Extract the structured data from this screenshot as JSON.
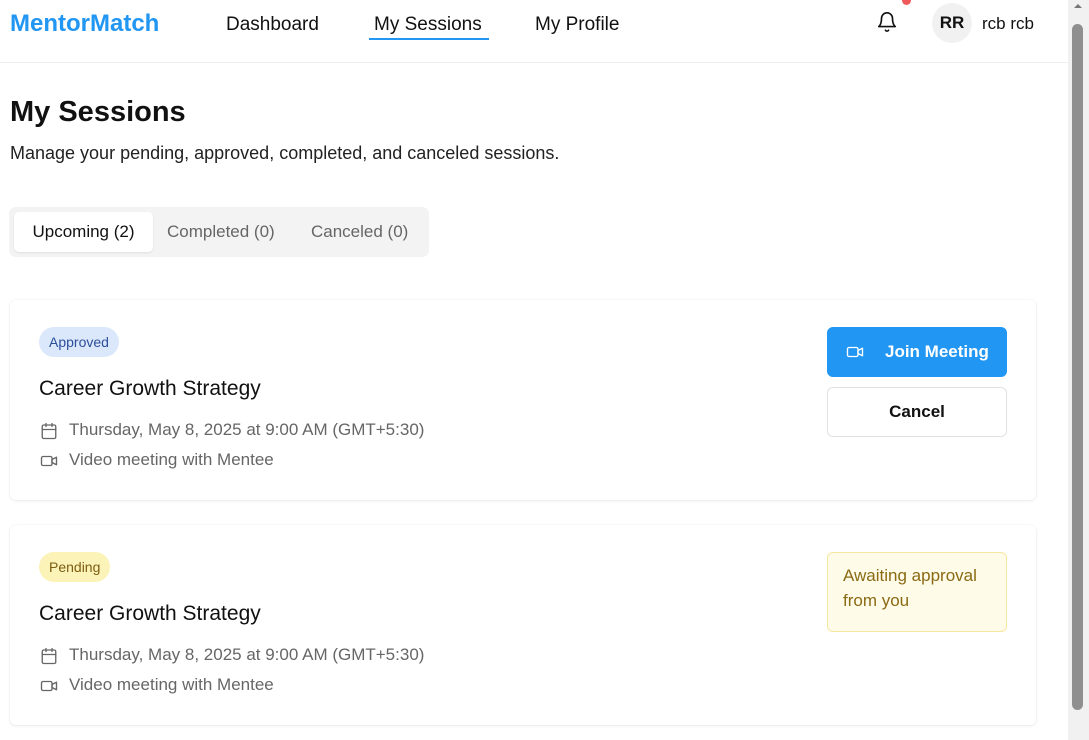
{
  "header": {
    "brand": "MentorMatch",
    "nav": {
      "dashboard": "Dashboard",
      "sessions": "My Sessions",
      "profile": "My Profile"
    },
    "avatar_initials": "RR",
    "username": "rcb rcb",
    "icons": {
      "notifications": "bell-icon"
    }
  },
  "page": {
    "title": "My Sessions",
    "subtitle": "Manage your pending, approved, completed, and canceled sessions."
  },
  "tabs": {
    "upcoming": "Upcoming (2)",
    "completed": "Completed (0)",
    "canceled": "Canceled (0)",
    "active": "upcoming"
  },
  "sessions": [
    {
      "status": "Approved",
      "title": "Career Growth Strategy",
      "datetime": "Thursday, May 8, 2025 at 9:00 AM (GMT+5:30)",
      "meeting_type": "Video meeting with Mentee",
      "join_label": "Join Meeting",
      "cancel_label": "Cancel"
    },
    {
      "status": "Pending",
      "title": "Career Growth Strategy",
      "datetime": "Thursday, May 8, 2025 at 9:00 AM (GMT+5:30)",
      "meeting_type": "Video meeting with Mentee",
      "awaiting_text": "Awaiting approval from you"
    }
  ],
  "colors": {
    "brand": "#2196f3",
    "approved_badge_bg": "#dbe8fb",
    "pending_badge_bg": "#fcf3b8",
    "awaiting_bg": "#fefbe8",
    "notification_dot": "#f05a5a"
  }
}
